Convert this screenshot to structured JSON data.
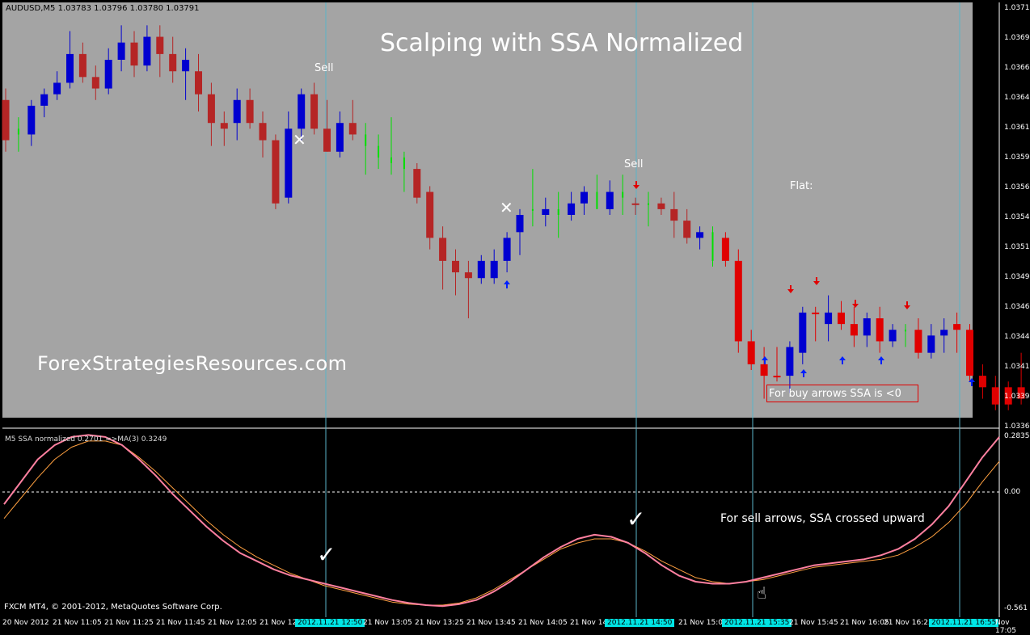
{
  "window": {
    "symbol_header": "AUDUSD,M5  1.03783 1.03796 1.03780 1.03791",
    "indicator_header": "M5 SSA normalized 0.2701  =>MA(3) 0.3249",
    "footer": "FXCM MT4, © 2001-2012, MetaQuotes Software Corp."
  },
  "annotations": {
    "title": "Scalping with SSA Normalized",
    "watermark": "ForexStrategiesResources.com",
    "sell_1": "Sell",
    "sell_2": "Sell",
    "flat": "Flat:",
    "buy_note": "For buy arrows SSA is <0",
    "sell_note": "For sell arrows, SSA crossed upward",
    "cross_mark": "✕",
    "check_mark": "✓",
    "hand_mark": "☝"
  },
  "colors": {
    "chart_bg": "#a4a4a4",
    "bull": "#0000d0",
    "bear": "#b52525",
    "bear_bright": "#e00000",
    "neutral_green": "#00e000",
    "ssa_line": "#ff80a0",
    "ma_line": "#ffa040",
    "vline": "#5ab4c8",
    "arrow_up": "#0020ff",
    "arrow_down": "#e00000"
  },
  "price_axis": [
    "1.03715",
    "1.03690",
    "1.03665",
    "1.03640",
    "1.03615",
    "1.03590",
    "1.03565",
    "1.03540",
    "1.03515",
    "1.03490",
    "1.03465",
    "1.03440",
    "1.03415",
    "1.03390",
    "1.03365"
  ],
  "indicator_axis": [
    "0.2835",
    "0.00",
    "-0.561"
  ],
  "time_axis": [
    {
      "label": "20 Nov 2012",
      "hi": false
    },
    {
      "label": "21 Nov 11:05",
      "hi": false
    },
    {
      "label": "21 Nov 11:25",
      "hi": false
    },
    {
      "label": "21 Nov 11:45",
      "hi": false
    },
    {
      "label": "21 Nov 12:05",
      "hi": false
    },
    {
      "label": "21 Nov 12",
      "hi": false
    },
    {
      "label": "2012.11.21 12:50",
      "hi": true
    },
    {
      "label": "21 Nov 13:05",
      "hi": false
    },
    {
      "label": "21 Nov 13:25",
      "hi": false
    },
    {
      "label": "21 Nov 13:45",
      "hi": false
    },
    {
      "label": "21 Nov 14:05",
      "hi": false
    },
    {
      "label": "21 Nov 14",
      "hi": false
    },
    {
      "label": "2012.11.21 14:50",
      "hi": true
    },
    {
      "label": "21 Nov 15:05",
      "hi": false
    },
    {
      "label": "2012.11.21 15:35",
      "hi": true
    },
    {
      "label": "21 Nov 15:45",
      "hi": false
    },
    {
      "label": "21 Nov 16:05",
      "hi": false
    },
    {
      "label": "21 Nov 16:25",
      "hi": false
    },
    {
      "label": "2012.11.21 16:55",
      "hi": true
    },
    {
      "label": "Nov 17:05",
      "hi": false
    }
  ],
  "chart_data": {
    "type": "candlestick",
    "symbol": "AUDUSD",
    "timeframe": "M5",
    "price_range": [
      1.0336,
      1.0372
    ],
    "candles": [
      {
        "o": 1.0364,
        "h": 1.0365,
        "l": 1.03595,
        "c": 1.03605,
        "k": "bear"
      },
      {
        "o": 1.0361,
        "h": 1.03625,
        "l": 1.03595,
        "c": 1.03615,
        "k": "green"
      },
      {
        "o": 1.0361,
        "h": 1.0364,
        "l": 1.036,
        "c": 1.03635,
        "k": "bull"
      },
      {
        "o": 1.03635,
        "h": 1.0365,
        "l": 1.03625,
        "c": 1.03645,
        "k": "bull"
      },
      {
        "o": 1.03645,
        "h": 1.03665,
        "l": 1.0364,
        "c": 1.03655,
        "k": "bull"
      },
      {
        "o": 1.03655,
        "h": 1.037,
        "l": 1.0365,
        "c": 1.0368,
        "k": "bull"
      },
      {
        "o": 1.0368,
        "h": 1.0369,
        "l": 1.03655,
        "c": 1.0366,
        "k": "bear"
      },
      {
        "o": 1.0366,
        "h": 1.0367,
        "l": 1.0364,
        "c": 1.0365,
        "k": "bear"
      },
      {
        "o": 1.0365,
        "h": 1.03685,
        "l": 1.03645,
        "c": 1.03675,
        "k": "bull"
      },
      {
        "o": 1.03675,
        "h": 1.03705,
        "l": 1.03665,
        "c": 1.0369,
        "k": "bull"
      },
      {
        "o": 1.0369,
        "h": 1.037,
        "l": 1.0366,
        "c": 1.0367,
        "k": "bear"
      },
      {
        "o": 1.0367,
        "h": 1.03705,
        "l": 1.03665,
        "c": 1.03695,
        "k": "bull"
      },
      {
        "o": 1.03695,
        "h": 1.03705,
        "l": 1.0366,
        "c": 1.0368,
        "k": "bear"
      },
      {
        "o": 1.0368,
        "h": 1.03695,
        "l": 1.03655,
        "c": 1.03665,
        "k": "bear"
      },
      {
        "o": 1.03665,
        "h": 1.03685,
        "l": 1.0364,
        "c": 1.03675,
        "k": "bull"
      },
      {
        "o": 1.03665,
        "h": 1.0368,
        "l": 1.0363,
        "c": 1.03645,
        "k": "bear"
      },
      {
        "o": 1.03645,
        "h": 1.03655,
        "l": 1.036,
        "c": 1.0362,
        "k": "bear"
      },
      {
        "o": 1.0362,
        "h": 1.0363,
        "l": 1.036,
        "c": 1.03615,
        "k": "bear"
      },
      {
        "o": 1.0362,
        "h": 1.0365,
        "l": 1.03605,
        "c": 1.0364,
        "k": "bull"
      },
      {
        "o": 1.0364,
        "h": 1.0365,
        "l": 1.03615,
        "c": 1.0362,
        "k": "bear"
      },
      {
        "o": 1.0362,
        "h": 1.0363,
        "l": 1.0359,
        "c": 1.03605,
        "k": "bear"
      },
      {
        "o": 1.03605,
        "h": 1.0361,
        "l": 1.03545,
        "c": 1.0355,
        "k": "bear"
      },
      {
        "o": 1.03555,
        "h": 1.0363,
        "l": 1.0355,
        "c": 1.03615,
        "k": "bull"
      },
      {
        "o": 1.03615,
        "h": 1.0365,
        "l": 1.03605,
        "c": 1.03645,
        "k": "bull"
      },
      {
        "o": 1.03645,
        "h": 1.03655,
        "l": 1.0361,
        "c": 1.03615,
        "k": "bear"
      },
      {
        "o": 1.03615,
        "h": 1.0364,
        "l": 1.03595,
        "c": 1.03595,
        "k": "bear"
      },
      {
        "o": 1.03595,
        "h": 1.0363,
        "l": 1.0359,
        "c": 1.0362,
        "k": "bull"
      },
      {
        "o": 1.0362,
        "h": 1.0364,
        "l": 1.03605,
        "c": 1.0361,
        "k": "bear"
      },
      {
        "o": 1.0361,
        "h": 1.0362,
        "l": 1.03575,
        "c": 1.036,
        "k": "green"
      },
      {
        "o": 1.036,
        "h": 1.0361,
        "l": 1.0358,
        "c": 1.0359,
        "k": "green"
      },
      {
        "o": 1.0359,
        "h": 1.03625,
        "l": 1.03575,
        "c": 1.03585,
        "k": "green"
      },
      {
        "o": 1.0359,
        "h": 1.03595,
        "l": 1.0356,
        "c": 1.0358,
        "k": "green"
      },
      {
        "o": 1.0358,
        "h": 1.03585,
        "l": 1.0355,
        "c": 1.03555,
        "k": "bear"
      },
      {
        "o": 1.0356,
        "h": 1.03565,
        "l": 1.0351,
        "c": 1.0352,
        "k": "bear"
      },
      {
        "o": 1.0352,
        "h": 1.0353,
        "l": 1.03475,
        "c": 1.035,
        "k": "bear"
      },
      {
        "o": 1.035,
        "h": 1.0351,
        "l": 1.0347,
        "c": 1.0349,
        "k": "bear"
      },
      {
        "o": 1.03485,
        "h": 1.035,
        "l": 1.0345,
        "c": 1.0349,
        "k": "bear"
      },
      {
        "o": 1.03485,
        "h": 1.03505,
        "l": 1.0348,
        "c": 1.035,
        "k": "bull"
      },
      {
        "o": 1.03485,
        "h": 1.0351,
        "l": 1.0348,
        "c": 1.035,
        "k": "bull"
      },
      {
        "o": 1.035,
        "h": 1.03525,
        "l": 1.0349,
        "c": 1.0352,
        "k": "bull"
      },
      {
        "o": 1.03525,
        "h": 1.03545,
        "l": 1.03505,
        "c": 1.0354,
        "k": "bull"
      },
      {
        "o": 1.03545,
        "h": 1.0358,
        "l": 1.0353,
        "c": 1.03545,
        "k": "green"
      },
      {
        "o": 1.0354,
        "h": 1.03555,
        "l": 1.0353,
        "c": 1.03545,
        "k": "bull"
      },
      {
        "o": 1.0354,
        "h": 1.0356,
        "l": 1.0352,
        "c": 1.03545,
        "k": "green"
      },
      {
        "o": 1.0354,
        "h": 1.0356,
        "l": 1.03535,
        "c": 1.0355,
        "k": "bull"
      },
      {
        "o": 1.0355,
        "h": 1.03565,
        "l": 1.0354,
        "c": 1.0356,
        "k": "bull"
      },
      {
        "o": 1.0356,
        "h": 1.03575,
        "l": 1.03545,
        "c": 1.03545,
        "k": "green"
      },
      {
        "o": 1.03545,
        "h": 1.0357,
        "l": 1.0354,
        "c": 1.0356,
        "k": "bull"
      },
      {
        "o": 1.0356,
        "h": 1.03575,
        "l": 1.0354,
        "c": 1.03555,
        "k": "green"
      },
      {
        "o": 1.0355,
        "h": 1.03555,
        "l": 1.0354,
        "c": 1.0355,
        "k": "bear"
      },
      {
        "o": 1.0355,
        "h": 1.0356,
        "l": 1.0353,
        "c": 1.0355,
        "k": "green"
      },
      {
        "o": 1.0355,
        "h": 1.03555,
        "l": 1.0354,
        "c": 1.03545,
        "k": "bear"
      },
      {
        "o": 1.03545,
        "h": 1.0356,
        "l": 1.0352,
        "c": 1.03535,
        "k": "bear"
      },
      {
        "o": 1.03535,
        "h": 1.03545,
        "l": 1.03515,
        "c": 1.0352,
        "k": "bear"
      },
      {
        "o": 1.0352,
        "h": 1.0353,
        "l": 1.0351,
        "c": 1.03525,
        "k": "bull"
      },
      {
        "o": 1.03525,
        "h": 1.0353,
        "l": 1.03495,
        "c": 1.035,
        "k": "green"
      },
      {
        "o": 1.035,
        "h": 1.03525,
        "l": 1.03495,
        "c": 1.0352,
        "k": "bear"
      },
      {
        "o": 1.035,
        "h": 1.0351,
        "l": 1.0342,
        "c": 1.0343,
        "k": "bear"
      },
      {
        "o": 1.0343,
        "h": 1.0344,
        "l": 1.03405,
        "c": 1.0341,
        "k": "bear"
      },
      {
        "o": 1.0341,
        "h": 1.03425,
        "l": 1.0338,
        "c": 1.034,
        "k": "bear"
      },
      {
        "o": 1.034,
        "h": 1.03425,
        "l": 1.03395,
        "c": 1.034,
        "k": "bear"
      },
      {
        "o": 1.034,
        "h": 1.0343,
        "l": 1.03385,
        "c": 1.03425,
        "k": "bull"
      },
      {
        "o": 1.0342,
        "h": 1.0346,
        "l": 1.0341,
        "c": 1.03455,
        "k": "bull"
      },
      {
        "o": 1.03455,
        "h": 1.0346,
        "l": 1.0343,
        "c": 1.03455,
        "k": "bear"
      },
      {
        "o": 1.03445,
        "h": 1.0347,
        "l": 1.0343,
        "c": 1.03455,
        "k": "bull"
      },
      {
        "o": 1.03455,
        "h": 1.03465,
        "l": 1.0344,
        "c": 1.03445,
        "k": "bear"
      },
      {
        "o": 1.03445,
        "h": 1.0346,
        "l": 1.03425,
        "c": 1.03435,
        "k": "bear"
      },
      {
        "o": 1.03435,
        "h": 1.03455,
        "l": 1.03425,
        "c": 1.0345,
        "k": "bull"
      },
      {
        "o": 1.0345,
        "h": 1.0346,
        "l": 1.0342,
        "c": 1.0343,
        "k": "bear"
      },
      {
        "o": 1.0343,
        "h": 1.03445,
        "l": 1.03425,
        "c": 1.0344,
        "k": "bull"
      },
      {
        "o": 1.0344,
        "h": 1.03445,
        "l": 1.03425,
        "c": 1.0344,
        "k": "green"
      },
      {
        "o": 1.0344,
        "h": 1.0345,
        "l": 1.03415,
        "c": 1.0342,
        "k": "bear"
      },
      {
        "o": 1.0342,
        "h": 1.03445,
        "l": 1.03415,
        "c": 1.03435,
        "k": "bull"
      },
      {
        "o": 1.03435,
        "h": 1.0345,
        "l": 1.0342,
        "c": 1.0344,
        "k": "bull"
      },
      {
        "o": 1.03445,
        "h": 1.03455,
        "l": 1.0342,
        "c": 1.0344,
        "k": "bear"
      },
      {
        "o": 1.0344,
        "h": 1.03445,
        "l": 1.03395,
        "c": 1.034,
        "k": "bear"
      },
      {
        "o": 1.034,
        "h": 1.0341,
        "l": 1.0338,
        "c": 1.0339,
        "k": "bear"
      },
      {
        "o": 1.0339,
        "h": 1.034,
        "l": 1.0337,
        "c": 1.03375,
        "k": "bear"
      },
      {
        "o": 1.03375,
        "h": 1.03395,
        "l": 1.0337,
        "c": 1.0339,
        "k": "bear"
      },
      {
        "o": 1.0339,
        "h": 1.0342,
        "l": 1.03375,
        "c": 1.0338,
        "k": "bear"
      },
      {
        "o": 1.03395,
        "h": 1.0343,
        "l": 1.03385,
        "c": 1.03425,
        "k": "bull"
      },
      {
        "o": 1.0342,
        "h": 1.0344,
        "l": 1.0341,
        "c": 1.0343,
        "k": "bear"
      },
      {
        "o": 1.03425,
        "h": 1.03445,
        "l": 1.0342,
        "c": 1.0344,
        "k": "green"
      },
      {
        "o": 1.0344,
        "h": 1.0346,
        "l": 1.0343,
        "c": 1.03455,
        "k": "green"
      }
    ],
    "indicator": {
      "range": [
        -0.561,
        0.2835
      ],
      "ssa": [
        -0.05,
        0.06,
        0.17,
        0.24,
        0.28,
        0.29,
        0.28,
        0.24,
        0.17,
        0.09,
        0.0,
        -0.08,
        -0.16,
        -0.23,
        -0.29,
        -0.33,
        -0.37,
        -0.4,
        -0.42,
        -0.44,
        -0.46,
        -0.48,
        -0.5,
        -0.52,
        -0.535,
        -0.545,
        -0.55,
        -0.54,
        -0.52,
        -0.48,
        -0.43,
        -0.37,
        -0.31,
        -0.26,
        -0.22,
        -0.2,
        -0.21,
        -0.24,
        -0.29,
        -0.35,
        -0.4,
        -0.43,
        -0.44,
        -0.44,
        -0.43,
        -0.41,
        -0.39,
        -0.37,
        -0.35,
        -0.34,
        -0.33,
        -0.32,
        -0.3,
        -0.27,
        -0.22,
        -0.15,
        -0.06,
        0.06,
        0.18,
        0.28
      ],
      "ma": [
        -0.12,
        -0.02,
        0.08,
        0.17,
        0.23,
        0.26,
        0.26,
        0.24,
        0.18,
        0.11,
        0.03,
        -0.05,
        -0.13,
        -0.2,
        -0.26,
        -0.31,
        -0.35,
        -0.39,
        -0.42,
        -0.45,
        -0.47,
        -0.49,
        -0.51,
        -0.53,
        -0.54,
        -0.545,
        -0.545,
        -0.535,
        -0.51,
        -0.47,
        -0.42,
        -0.37,
        -0.32,
        -0.27,
        -0.24,
        -0.22,
        -0.22,
        -0.24,
        -0.28,
        -0.33,
        -0.37,
        -0.41,
        -0.43,
        -0.44,
        -0.43,
        -0.42,
        -0.4,
        -0.38,
        -0.36,
        -0.35,
        -0.34,
        -0.33,
        -0.32,
        -0.3,
        -0.26,
        -0.21,
        -0.14,
        -0.05,
        0.06,
        0.16
      ]
    }
  }
}
